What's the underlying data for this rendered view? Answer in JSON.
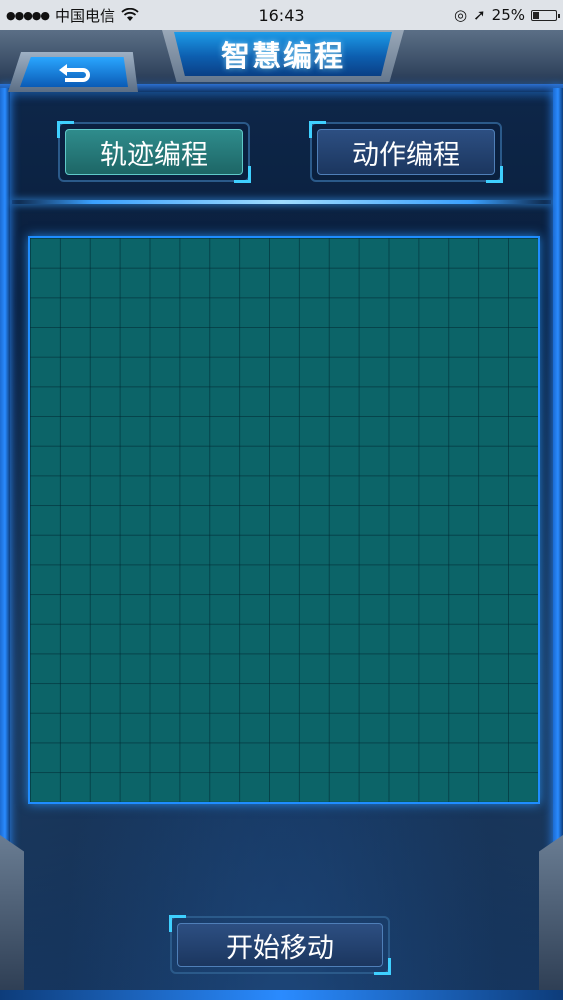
{
  "status_bar": {
    "carrier": "中国电信",
    "time": "16:43",
    "battery": "25%",
    "battery_level": 0.25
  },
  "header": {
    "title": "智慧编程",
    "back_icon": "back-arrow-icon"
  },
  "tabs": [
    {
      "label": "轨迹编程",
      "active": true
    },
    {
      "label": "动作编程",
      "active": false
    }
  ],
  "grid": {
    "columns": 17,
    "rows": 19,
    "fill_color": "#0c6468",
    "border_color": "#1f8dff"
  },
  "actions": {
    "start_label": "开始移动"
  },
  "colors": {
    "accent": "#1f8dff",
    "title_blue": "#1d9be8",
    "active_tab": "#2f8c8c",
    "inactive_tab": "#2d4f82"
  }
}
